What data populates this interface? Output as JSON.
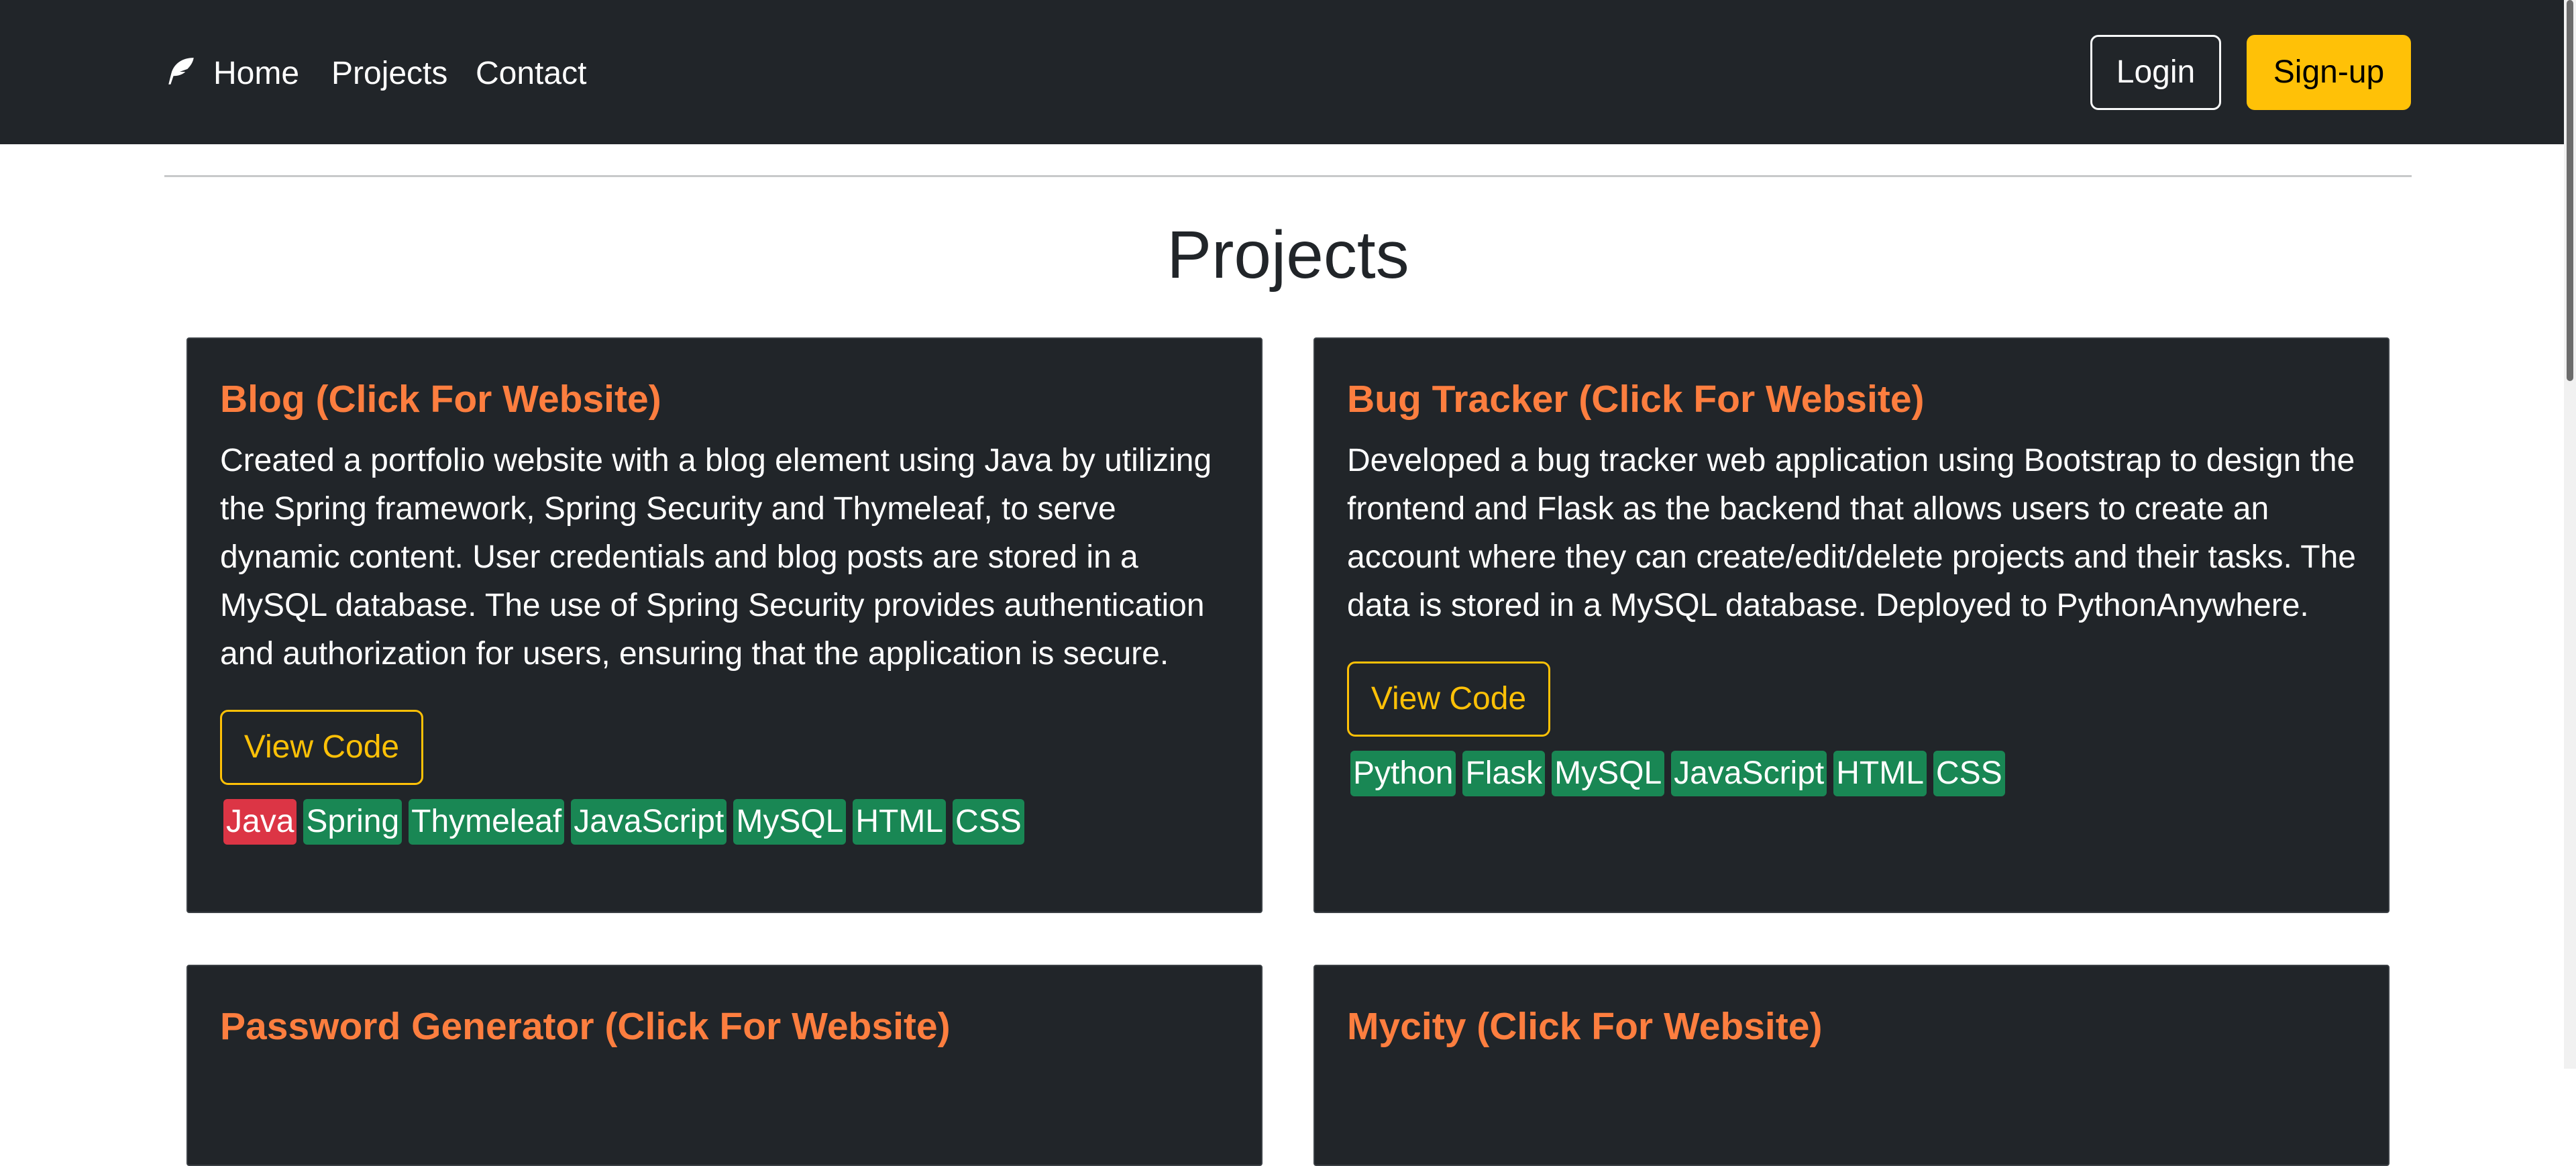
{
  "nav": {
    "brand_icon": "feather-icon",
    "links": [
      {
        "label": "Home"
      },
      {
        "label": "Projects"
      },
      {
        "label": "Contact"
      }
    ],
    "login_label": "Login",
    "signup_label": "Sign-up"
  },
  "page": {
    "title": "Projects"
  },
  "projects": [
    {
      "title": "Blog (Click For Website)",
      "description": "Created a portfolio website with a blog element using Java by utilizing the Spring framework, Spring Security and Thymeleaf, to serve dynamic content. User credentials and blog posts are stored in a MySQL database. The use of Spring Security provides authentication and authorization for users, ensuring that the application is secure.",
      "button_label": "View Code",
      "tags": [
        "Java",
        "Spring",
        "Thymeleaf",
        "JavaScript",
        "MySQL",
        "HTML",
        "CSS"
      ]
    },
    {
      "title": "Bug Tracker (Click For Website)",
      "description": "Developed a bug tracker web application using Bootstrap to design the frontend and Flask as the backend that allows users to create an account where they can create/edit/delete projects and their tasks. The data is stored in a MySQL database. Deployed to PythonAnywhere.",
      "button_label": "View Code",
      "tags": [
        "Python",
        "Flask",
        "MySQL",
        "JavaScript",
        "HTML",
        "CSS"
      ]
    },
    {
      "title": "Password Generator (Click For Website)"
    },
    {
      "title": "Mycity (Click For Website)"
    }
  ],
  "colors": {
    "navbar_bg": "#212529",
    "accent_yellow": "#ffc107",
    "title_orange": "#fd7e3f",
    "badge_green": "#198754",
    "badge_red": "#dc3545"
  }
}
